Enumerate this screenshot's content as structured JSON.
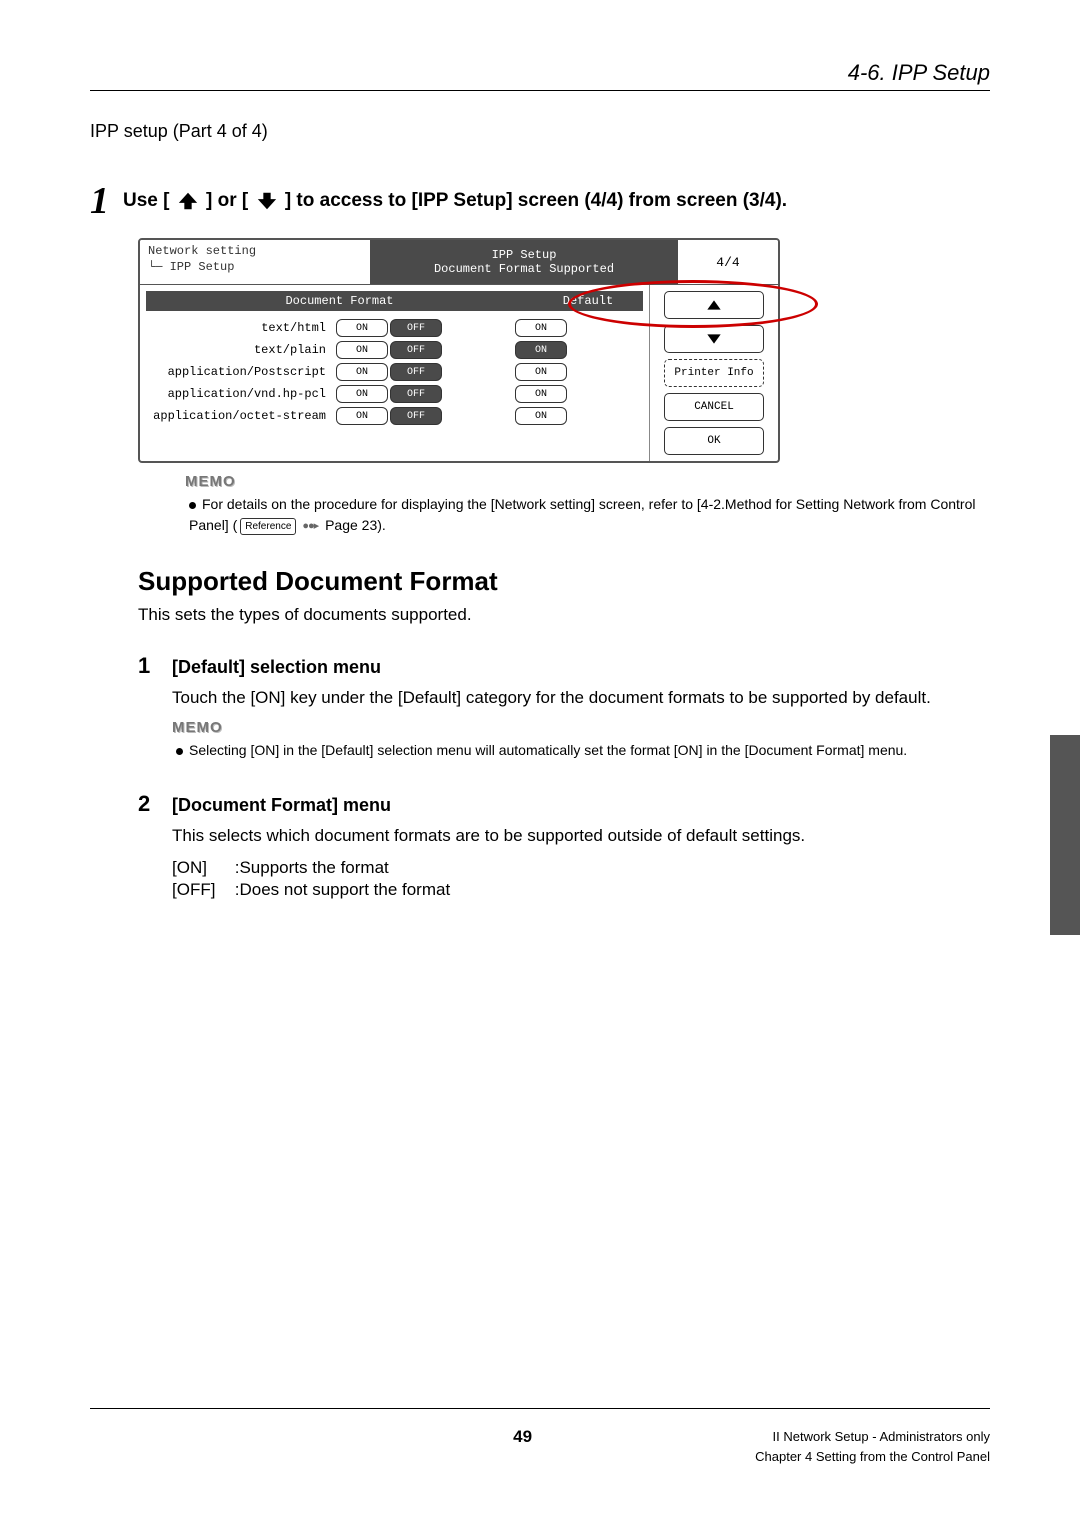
{
  "header": {
    "title": "4-6. IPP Setup"
  },
  "part_title": "IPP setup (Part 4 of 4)",
  "step1": {
    "num": "1",
    "pre": "Use [",
    "mid": "] or [",
    "post": "] to access to [IPP Setup] screen (4/4) from screen (3/4)."
  },
  "screenshot": {
    "title_left_line1": "Network setting",
    "title_left_line2": "└─ IPP Setup",
    "title_center_line1": "IPP Setup",
    "title_center_line2": "Document Format Supported",
    "title_right": "4/4",
    "col_left": "Document Format",
    "col_right": "Default",
    "rows": [
      {
        "label": "text/html",
        "on": "ON",
        "off": "OFF",
        "def": "ON"
      },
      {
        "label": "text/plain",
        "on": "ON",
        "off": "OFF",
        "def": "ON"
      },
      {
        "label": "application/Postscript",
        "on": "ON",
        "off": "OFF",
        "def": "ON"
      },
      {
        "label": "application/vnd.hp-pcl",
        "on": "ON",
        "off": "OFF",
        "def": "ON"
      },
      {
        "label": "application/octet-stream",
        "on": "ON",
        "off": "OFF",
        "def": "ON"
      }
    ],
    "side": {
      "printer_info": "Printer Info",
      "cancel": "CANCEL",
      "ok": "OK"
    }
  },
  "memo1": {
    "label": "MEMO",
    "text_pre": "For details on the procedure for displaying the [Network setting] screen, refer to [4-2.Method for Setting Network from Control Panel] (",
    "ref": "Reference",
    "text_post": " Page 23)."
  },
  "section": {
    "heading": "Supported Document Format",
    "desc": "This sets the types of documents supported."
  },
  "sub1": {
    "num": "1",
    "title": "[Default] selection menu",
    "body": "Touch the [ON] key under the [Default] category for the document formats to be supported by default.",
    "memo_label": "MEMO",
    "memo_text": "Selecting [ON] in the [Default] selection menu will automatically set the format [ON] in the [Document Format] menu."
  },
  "sub2": {
    "num": "2",
    "title": "[Document Format] menu",
    "body": "This selects which document formats are to be supported outside of default settings.",
    "kv": [
      {
        "k": "[ON]",
        "v": ":Supports the format"
      },
      {
        "k": "[OFF]",
        "v": ":Does not support the format"
      }
    ]
  },
  "footer": {
    "page": "49",
    "right1": "II Network Setup - Administrators only",
    "right2": "Chapter 4 Setting from the Control Panel"
  }
}
